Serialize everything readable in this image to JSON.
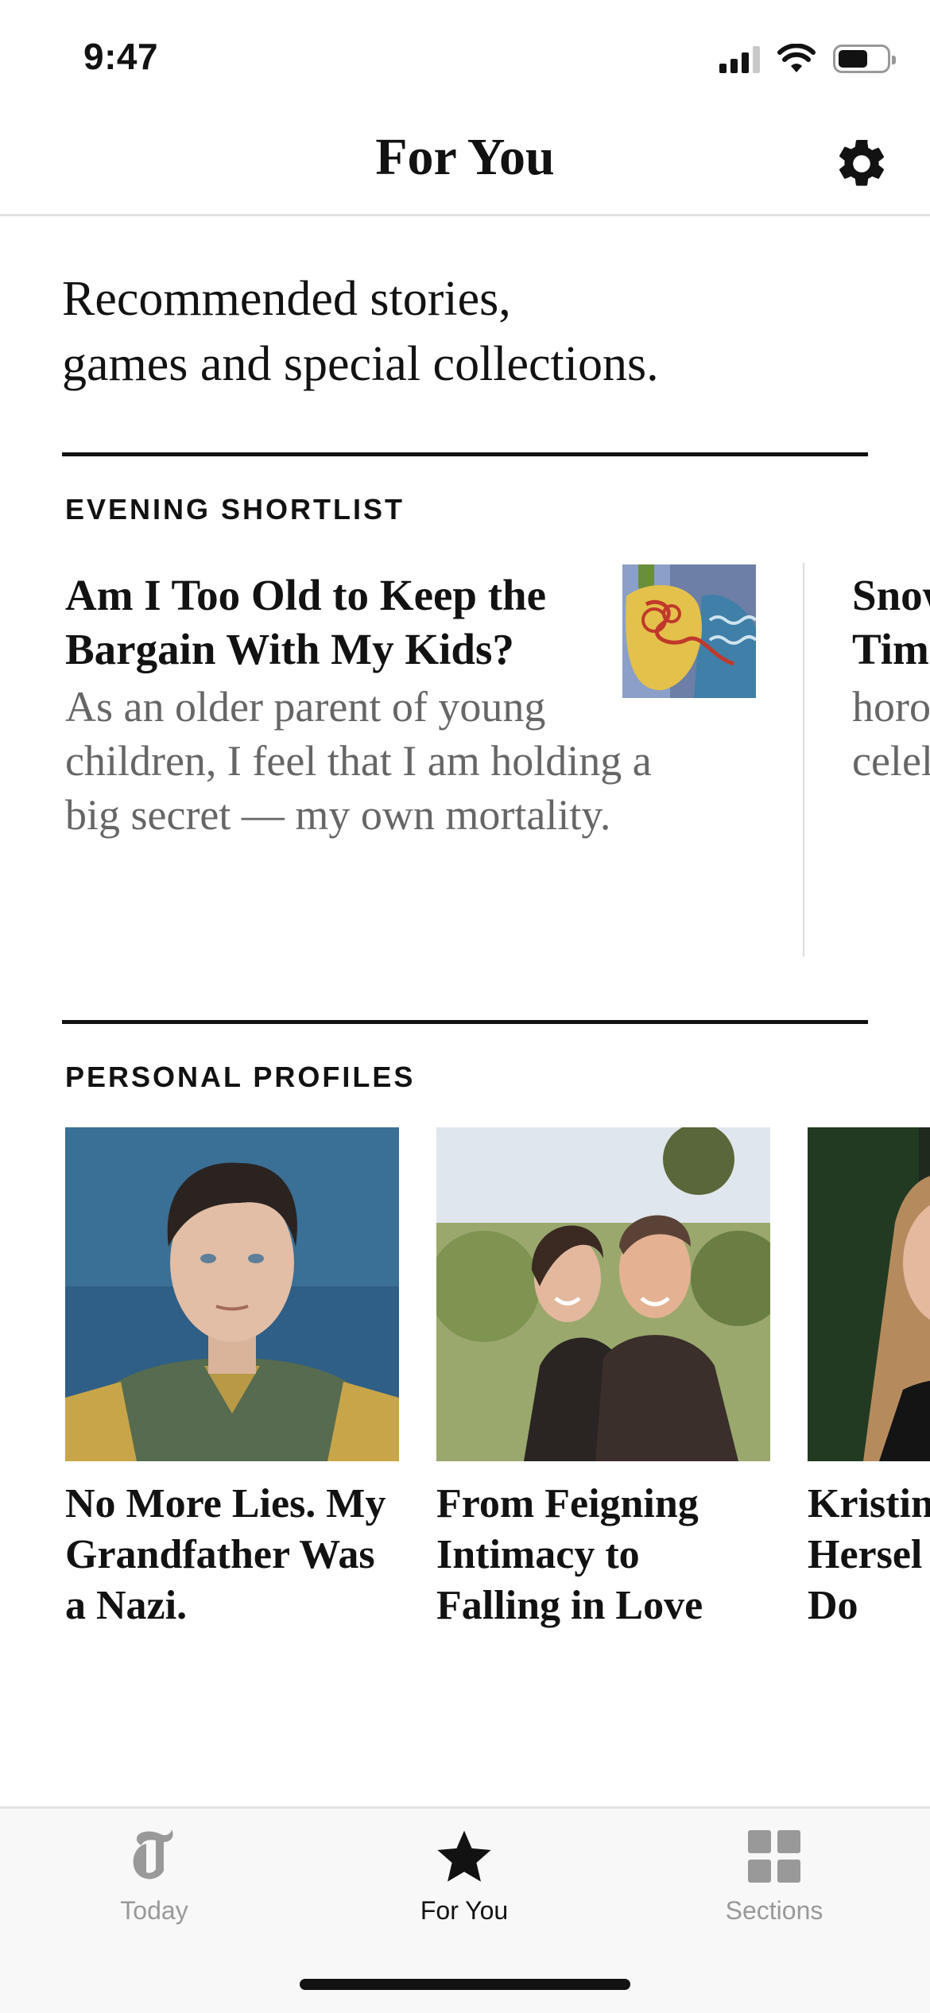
{
  "status_bar": {
    "time": "9:47"
  },
  "header": {
    "title": "For You",
    "settings_icon": "gear-icon"
  },
  "intro": {
    "line1": "Recommended stories,",
    "line2": "games and special collections."
  },
  "evening_shortlist": {
    "label": "EVENING SHORTLIST",
    "stories": [
      {
        "headline": "Am I Too Old to Keep the Bargain With My Kids?",
        "summary": "As an older parent of young children, I feel that I am holding a big secret — my own mortality."
      },
      {
        "headline": "Snow Cen Tim",
        "summary": "horo whit celel"
      }
    ]
  },
  "personal_profiles": {
    "label": "PERSONAL PROFILES",
    "items": [
      {
        "title": "No More Lies. My Grandfather Was a Nazi."
      },
      {
        "title": "From Feigning Intimacy to Falling in Love"
      },
      {
        "title": "Kristin Reinve Hersel Thinks Can Do"
      }
    ]
  },
  "tab_bar": {
    "tabs": [
      {
        "label": "Today",
        "icon": "nyt-logo-icon",
        "active": false
      },
      {
        "label": "For You",
        "icon": "star-icon",
        "active": true
      },
      {
        "label": "Sections",
        "icon": "grid-icon",
        "active": false
      }
    ]
  },
  "colors": {
    "text": "#121212",
    "secondary": "#666666",
    "inactive_tab": "#999999",
    "divider": "#e2e2e2"
  }
}
